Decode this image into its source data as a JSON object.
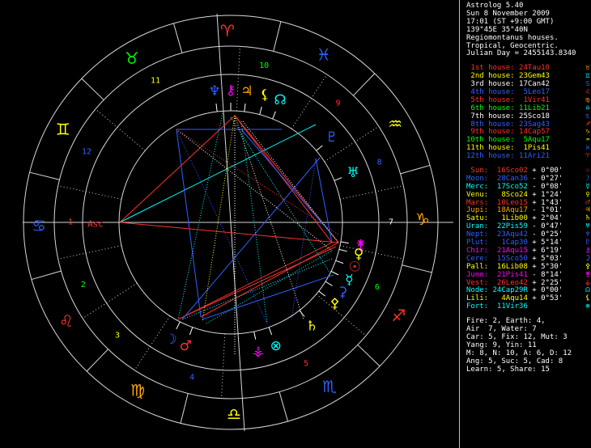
{
  "header": {
    "app_title": "Astrolog 5.40",
    "date": "Sun 8 November 2009",
    "time": "17:01 (ST +9:00 GMT)",
    "location": "139°45E 35°40N",
    "house_system": "Regiomontanus houses.",
    "zodiac": "Tropical, Geocentric.",
    "julian_day": "Julian Day = 2455143.8340"
  },
  "houses": [
    {
      "label": "1st house:",
      "value": "24Tau10",
      "color": "#ff3030",
      "glyph": "♉",
      "glyph_color": "#ffa500"
    },
    {
      "label": "2nd house:",
      "value": "23Gem43",
      "color": "#ffff00",
      "glyph": "♊",
      "glyph_color": "#00ffff"
    },
    {
      "label": "3rd house:",
      "value": "17Can42",
      "color": "#ffffff",
      "glyph": "♋",
      "glyph_color": "#3060ff"
    },
    {
      "label": "4th house:",
      "value": "5Leo17",
      "color": "#3060ff",
      "glyph": "♌",
      "glyph_color": "#ff3030"
    },
    {
      "label": "5th house:",
      "value": "1Vir41",
      "color": "#ff3030",
      "glyph": "♍",
      "glyph_color": "#ffa500"
    },
    {
      "label": "6th house:",
      "value": "11Lib21",
      "color": "#00ff00",
      "glyph": "♎",
      "glyph_color": "#00ffff"
    },
    {
      "label": "7th house:",
      "value": "25Sco18",
      "color": "#ffffff",
      "glyph": "♏",
      "glyph_color": "#3060ff"
    },
    {
      "label": "8th house:",
      "value": "23Sag43",
      "color": "#3060ff",
      "glyph": "♐",
      "glyph_color": "#ff3030"
    },
    {
      "label": "9th house:",
      "value": "14Cap57",
      "color": "#ff3030",
      "glyph": "♑",
      "glyph_color": "#ffa500"
    },
    {
      "label": "10th house:",
      "value": "5Aqu17",
      "color": "#00ff00",
      "glyph": "♒",
      "glyph_color": "#ffff00"
    },
    {
      "label": "11th house:",
      "value": "1Pis41",
      "color": "#ffff00",
      "glyph": "♓",
      "glyph_color": "#3060ff"
    },
    {
      "label": "12th house:",
      "value": "11Ari21",
      "color": "#3060ff",
      "glyph": "♈",
      "glyph_color": "#ff3030"
    }
  ],
  "planets": [
    {
      "label": "Sun:",
      "value": "16Sco02",
      "speed": "+ 0°00'",
      "color": "#ff3030",
      "glyph": "☉",
      "glyph_color": "#ff3030"
    },
    {
      "label": "Moon:",
      "value": "28Can36",
      "speed": "- 0°27'",
      "color": "#3060ff",
      "glyph": "☽",
      "glyph_color": "#3060ff"
    },
    {
      "label": "Merc:",
      "value": "17Sco52",
      "speed": "- 0°08'",
      "color": "#00ffff",
      "glyph": "☿",
      "glyph_color": "#00ffff"
    },
    {
      "label": "Venu:",
      "value": "8Sco24",
      "speed": "+ 1°24'",
      "color": "#ffff00",
      "glyph": "♀",
      "glyph_color": "#ffff00"
    },
    {
      "label": "Mars:",
      "value": "10Leo15",
      "speed": "+ 1°43'",
      "color": "#ff3030",
      "glyph": "♂",
      "glyph_color": "#ff3030"
    },
    {
      "label": "Jupi:",
      "value": "18Aqu17",
      "speed": "- 1°01'",
      "color": "#ffa500",
      "glyph": "♃",
      "glyph_color": "#ffa500"
    },
    {
      "label": "Satu:",
      "value": "1Lib00",
      "speed": "+ 2°04'",
      "color": "#ffff00",
      "glyph": "♄",
      "glyph_color": "#ffff00"
    },
    {
      "label": "Uran:",
      "value": "22Pis59",
      "speed": "- 0°47'",
      "color": "#00ffff",
      "glyph": "♅",
      "glyph_color": "#00ffff"
    },
    {
      "label": "Nept:",
      "value": "23Aqu42",
      "speed": "- 0°25'",
      "color": "#3060ff",
      "glyph": "♆",
      "glyph_color": "#3060ff"
    },
    {
      "label": "Plut:",
      "value": "1Cap30",
      "speed": "+ 5°14'",
      "color": "#3060ff",
      "glyph": "♇",
      "glyph_color": "#3060ff"
    },
    {
      "label": "Chir:",
      "value": "21Aqu15",
      "speed": "+ 6°19'",
      "color": "#ff00ff",
      "glyph": "⚷",
      "glyph_color": "#ff00ff"
    },
    {
      "label": "Cere:",
      "value": "15Sco50",
      "speed": "+ 5°03'",
      "color": "#3060ff",
      "glyph": "⚳",
      "glyph_color": "#3060ff"
    },
    {
      "label": "Pall:",
      "value": "16Lib08",
      "speed": "+ 5°30'",
      "color": "#ffff00",
      "glyph": "⚴",
      "glyph_color": "#ffff00"
    },
    {
      "label": "Juno:",
      "value": "21Pis41",
      "speed": "- 8°14'",
      "color": "#ff00ff",
      "glyph": "⚵",
      "glyph_color": "#ff00ff"
    },
    {
      "label": "Vest:",
      "value": "26Leo42",
      "speed": "+ 2°25'",
      "color": "#ff3030",
      "glyph": "⚶",
      "glyph_color": "#ff3030"
    },
    {
      "label": "Node:",
      "value": "24Cap29R",
      "speed": "+ 0°00'",
      "color": "#00ffff",
      "glyph": "☊",
      "glyph_color": "#00ffff"
    },
    {
      "label": "Lili:",
      "value": "4Aqu14",
      "speed": "+ 0°53'",
      "color": "#ffff00",
      "glyph": "⚸",
      "glyph_color": "#ffff00"
    },
    {
      "label": "Fort:",
      "value": "11Vir36",
      "speed": "",
      "color": "#00ffff",
      "glyph": "⊗",
      "glyph_color": "#00ffff"
    }
  ],
  "stats": [
    "Fire: 2, Earth: 4,",
    "Air  7, Water: 7",
    "Car: 5, Fix: 12, Mut: 3",
    "Yang: 9, Yin: 11",
    "M: 8, N: 10, A: 6, D: 12",
    "Ang: 5, Suc: 5, Cad: 8",
    "Learn: 5, Share: 15"
  ],
  "wheel": {
    "asc_label": "Asc",
    "signs": [
      {
        "glyph": "♓",
        "color": "#3060ff"
      },
      {
        "glyph": "♒",
        "color": "#ffff00"
      },
      {
        "glyph": "♑",
        "color": "#ffa500"
      },
      {
        "glyph": "♐",
        "color": "#ff3030"
      },
      {
        "glyph": "♏",
        "color": "#3060ff"
      },
      {
        "glyph": "♎",
        "color": "#ffff00"
      },
      {
        "glyph": "♍",
        "color": "#ffa500"
      },
      {
        "glyph": "♌",
        "color": "#ff3030"
      },
      {
        "glyph": "♋",
        "color": "#3060ff"
      },
      {
        "glyph": "♊",
        "color": "#ffff00"
      },
      {
        "glyph": "♉",
        "color": "#00ff00"
      },
      {
        "glyph": "♈",
        "color": "#ff3030"
      }
    ],
    "house_numbers": [
      {
        "n": "10",
        "color": "#00ff00"
      },
      {
        "n": "9",
        "color": "#ff3030"
      },
      {
        "n": "8",
        "color": "#3060ff"
      },
      {
        "n": "7",
        "color": "#ffffff"
      },
      {
        "n": "6",
        "color": "#00ff00"
      },
      {
        "n": "5",
        "color": "#ff3030"
      },
      {
        "n": "4",
        "color": "#3060ff"
      },
      {
        "n": "3",
        "color": "#ffff00"
      },
      {
        "n": "2",
        "color": "#00ff00"
      },
      {
        "n": "1",
        "color": "#ff3030"
      },
      {
        "n": "12",
        "color": "#3060ff"
      },
      {
        "n": "11",
        "color": "#ffff00"
      }
    ],
    "planet_glyphs": [
      {
        "name": "neptune",
        "glyph": "♆",
        "color": "#3060ff"
      },
      {
        "name": "chiron",
        "glyph": "⚷",
        "color": "#ff00ff"
      },
      {
        "name": "jupiter",
        "glyph": "♃",
        "color": "#ffa500"
      },
      {
        "name": "lilith",
        "glyph": "⚸",
        "color": "#ffff00"
      },
      {
        "name": "node",
        "glyph": "☊",
        "color": "#00ffff"
      },
      {
        "name": "pluto",
        "glyph": "♇",
        "color": "#3060ff"
      },
      {
        "name": "uranus",
        "glyph": "♅",
        "color": "#00ffff"
      },
      {
        "name": "juno",
        "glyph": "⚵",
        "color": "#ff00ff"
      },
      {
        "name": "venus",
        "glyph": "♀",
        "color": "#ffff00"
      },
      {
        "name": "sun",
        "glyph": "☉",
        "color": "#ff3030"
      },
      {
        "name": "mercury",
        "glyph": "☿",
        "color": "#00ffff"
      },
      {
        "name": "ceres",
        "glyph": "⚳",
        "color": "#3060ff"
      },
      {
        "name": "pallas",
        "glyph": "⚴",
        "color": "#ffff00"
      },
      {
        "name": "saturn",
        "glyph": "♄",
        "color": "#ffff00"
      },
      {
        "name": "fortune",
        "glyph": "⊗",
        "color": "#00ffff"
      },
      {
        "name": "vesta",
        "glyph": "⚶",
        "color": "#ff00ff"
      },
      {
        "name": "mars",
        "glyph": "♂",
        "color": "#ff3030"
      },
      {
        "name": "moon",
        "glyph": "☽",
        "color": "#3060ff"
      }
    ]
  }
}
